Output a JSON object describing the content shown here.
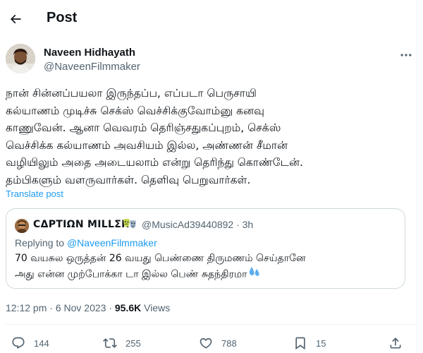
{
  "header": {
    "title": "Post"
  },
  "author": {
    "name": "Naveen Hidhayath",
    "handle": "@NaveenFilmmaker"
  },
  "tweet": {
    "lines": [
      "நான் சின்னப்பயலா இருந்தப்ப, எப்படா பெருசாயி",
      "கல்யாணம் முடிச்சு செக்ஸ் வெச்சிக்குவோம்னு கனவு",
      "காணுவேன். ஆனா வெவரம் தெரிஞ்சதுகப்புறம், செக்ஸ்",
      "வெச்சிக்க கல்யாணம் அவசியம் இல்ல, அண்ணன் சீமான்",
      "வழியிலும் அதை அடையலாம் என்று தெரிந்து கொண்டேன்.",
      "தம்பிகளும் வளருவார்கள். தெளிவு பெறுவார்கள்."
    ],
    "translate_label": "Translate post"
  },
  "quote": {
    "name": "CΔPTIΩN MILLΣR",
    "handle": "@MusicAd39440892",
    "separator": "·",
    "time": "3h",
    "replying_prefix": "Replying to",
    "replying_handle": "@NaveenFilmmaker",
    "lines": [
      "70 வயசுல ஒருத்தன் 26 வயது பெண்ணை திருமணம் செய்தானே",
      "அது என்ன முற்போக்கா டா இல்ல பெண் சுதந்திரமா"
    ]
  },
  "meta": {
    "time": "12:12 pm",
    "dot1": "·",
    "date": "6 Nov 2023",
    "dot2": "·",
    "views_count": "95.6K",
    "views_label": "Views"
  },
  "actions": {
    "replies": "144",
    "reposts": "255",
    "likes": "788",
    "bookmarks": "15"
  },
  "colors": {
    "text": "#0f1419",
    "secondary": "#536471",
    "link": "#1d9bf0",
    "border": "#cfd9de"
  }
}
